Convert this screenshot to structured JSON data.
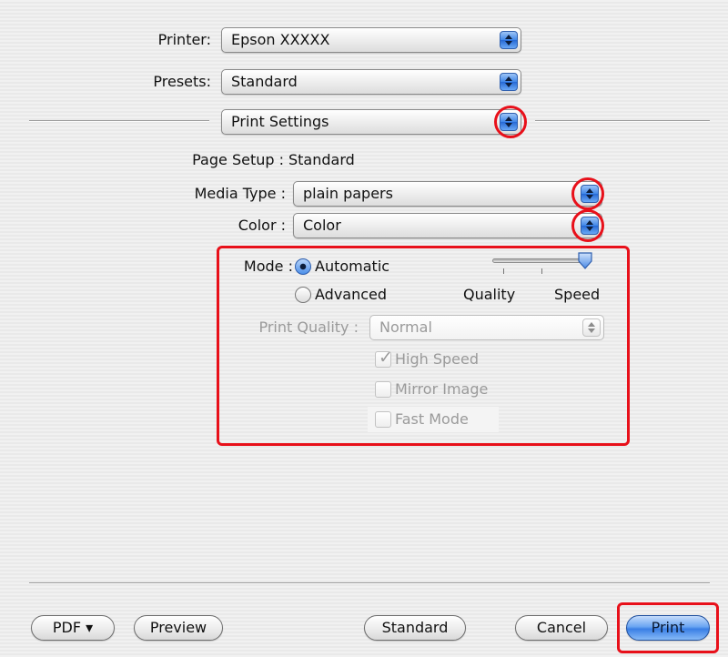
{
  "printer": {
    "label": "Printer:",
    "value": "Epson XXXXX"
  },
  "presets": {
    "label": "Presets:",
    "value": "Standard"
  },
  "panel": {
    "value": "Print Settings"
  },
  "page_setup": {
    "label": "Page Setup :",
    "value": "Standard"
  },
  "media_type": {
    "label": "Media Type :",
    "value": "plain papers"
  },
  "color": {
    "label": "Color :",
    "value": "Color"
  },
  "mode": {
    "label": "Mode :",
    "automatic": "Automatic",
    "advanced": "Advanced",
    "selected": "Automatic",
    "slider": {
      "left_label": "Quality",
      "right_label": "Speed",
      "level": 1.0
    }
  },
  "print_quality": {
    "label": "Print Quality :",
    "value": "Normal",
    "enabled": false
  },
  "options": {
    "high_speed": {
      "label": "High Speed",
      "checked": true,
      "enabled": false
    },
    "mirror_image": {
      "label": "Mirror Image",
      "checked": false,
      "enabled": false
    },
    "fast_mode": {
      "label": "Fast Mode",
      "checked": false,
      "enabled": false
    }
  },
  "footer": {
    "pdf": "PDF ▾",
    "preview": "Preview",
    "standard": "Standard",
    "cancel": "Cancel",
    "print": "Print"
  },
  "colors": {
    "highlight": "#e8101a",
    "accent": "#3a7fe5"
  }
}
